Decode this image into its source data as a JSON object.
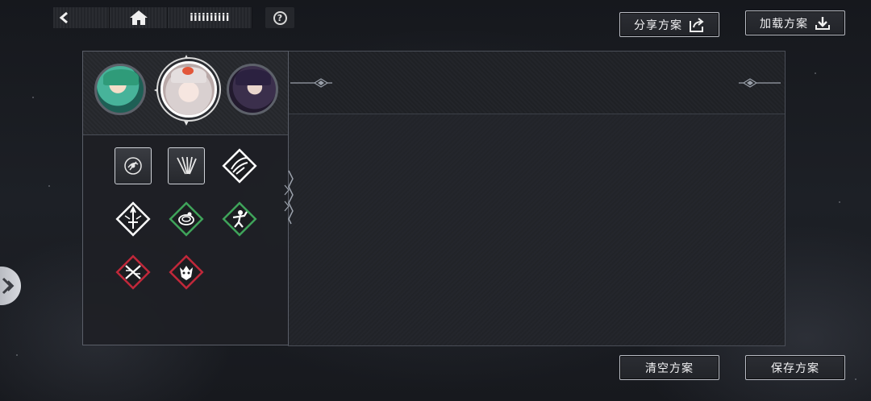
{
  "nav": {
    "back_icon": "back-arrow-icon",
    "home_icon": "home-icon",
    "title": "iiiiiiiiii",
    "help_label": "?"
  },
  "actions": {
    "share_label": "分享方案",
    "load_label": "加载方案",
    "clear_label": "清空方案",
    "save_label": "保存方案"
  },
  "portraits": [
    {
      "name": "green-hair-character",
      "selected": false
    },
    {
      "name": "white-hair-character",
      "selected": true
    },
    {
      "name": "dark-hair-character",
      "selected": false
    }
  ],
  "skills": [
    {
      "icon": "round-emblem-icon",
      "shape": "square",
      "color": "#e6e6e6"
    },
    {
      "icon": "claw-marks-icon",
      "shape": "square",
      "color": "#e6e6e6"
    },
    {
      "icon": "wind-slash-icon",
      "shape": "diamond",
      "color": "#ffffff"
    },
    {
      "icon": "sword-icon",
      "shape": "diamond",
      "color": "#ffffff"
    },
    {
      "icon": "coiled-snake-icon",
      "shape": "diamond",
      "color": "#3fa35a"
    },
    {
      "icon": "warrior-figure-icon",
      "shape": "diamond",
      "color": "#3fa35a"
    },
    {
      "icon": "crossed-blades-icon",
      "shape": "diamond",
      "color": "#c0283a"
    },
    {
      "icon": "beast-head-icon",
      "shape": "diamond",
      "color": "#c0283a"
    }
  ],
  "colors": {
    "button_border": "#b9bcc4",
    "panel_border": "#4a4e57",
    "green_tier": "#3fa35a",
    "red_tier": "#c0283a"
  }
}
